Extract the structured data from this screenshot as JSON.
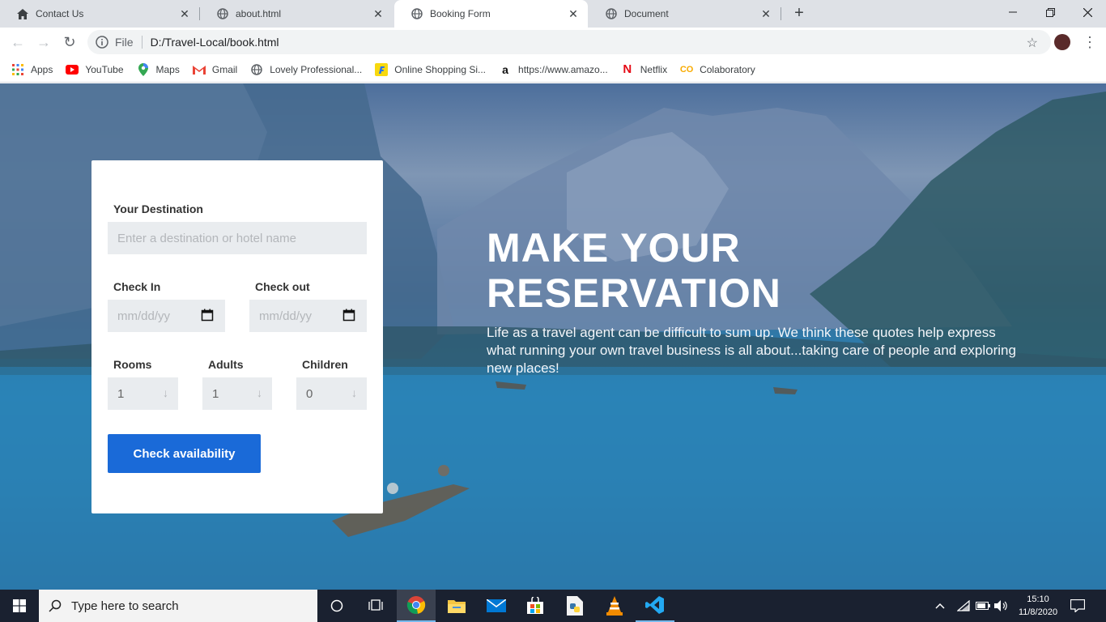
{
  "browser": {
    "tabs": [
      {
        "title": "Contact Us",
        "icon": "home-icon"
      },
      {
        "title": "about.html",
        "icon": "globe-icon"
      },
      {
        "title": "Booking Form",
        "icon": "globe-icon"
      },
      {
        "title": "Document",
        "icon": "globe-icon"
      }
    ],
    "address": {
      "scheme": "File",
      "url": "D:/Travel-Local/book.html"
    },
    "bookmarks": [
      {
        "label": "Apps",
        "icon": "apps-grid-icon"
      },
      {
        "label": "YouTube",
        "icon": "youtube-icon"
      },
      {
        "label": "Maps",
        "icon": "maps-pin-icon"
      },
      {
        "label": "Gmail",
        "icon": "gmail-icon"
      },
      {
        "label": "Lovely Professional...",
        "icon": "globe-icon"
      },
      {
        "label": "Online Shopping Si...",
        "icon": "flipkart-icon"
      },
      {
        "label": "https://www.amazo...",
        "icon": "amazon-icon"
      },
      {
        "label": "Netflix",
        "icon": "netflix-icon"
      },
      {
        "label": "Colaboratory",
        "icon": "colab-icon"
      }
    ]
  },
  "form": {
    "destination_label": "Your Destination",
    "destination_placeholder": "Enter a destination or hotel name",
    "checkin_label": "Check In",
    "checkout_label": "Check out",
    "date_placeholder": "mm/dd/yy",
    "rooms_label": "Rooms",
    "adults_label": "Adults",
    "children_label": "Children",
    "rooms_value": "1",
    "adults_value": "1",
    "children_value": "0",
    "submit_label": "Check availability"
  },
  "hero": {
    "title_line1": "MAKE YOUR",
    "title_line2": "RESERVATION",
    "text": "Life as a travel agent can be difficult to sum up. We think these quotes help express what running your own travel business is all about...taking care of people and exploring new places!"
  },
  "taskbar": {
    "search_placeholder": "Type here to search",
    "time": "15:10",
    "date": "11/8/2020"
  },
  "colors": {
    "accent": "#1a6ad8",
    "taskbar": "#1a2130"
  }
}
